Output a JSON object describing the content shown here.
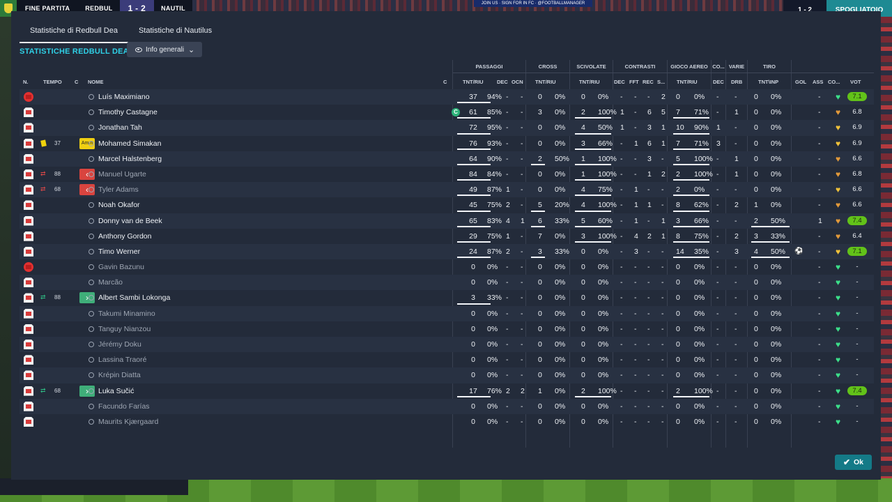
{
  "scoreboard": {
    "status": "FINE PARTITA",
    "home": "REDBUL",
    "score": "1 - 2",
    "away": "NAUTIL",
    "mini_score": "1 - 2",
    "button": "SPOGLIATOIO",
    "ad": "JOIN US · SIGN FOR IN FC · @FOOTBALLMANAGER"
  },
  "tabs": [
    "Statistiche di Redbull Dea",
    "Statistiche di Nautilus"
  ],
  "section_title": "STATISTICHE REDBULL DEA",
  "dropdown": {
    "label": "Info generali",
    "icon": "eye-icon"
  },
  "group_headers": {
    "passaggi": "PASSAGGI",
    "cross": "CROSS",
    "scivolate": "SCIVOLATE",
    "contrasti": "CONTRASTI",
    "gioco_aereo": "GIOCO AEREO",
    "co": "CO...",
    "varie": "VARIE",
    "tiro": "TIRO"
  },
  "column_headers": {
    "n": "N.",
    "tempo": "TEMPO",
    "c": "C",
    "nome": "NOME",
    "cap": "C",
    "pass": "TNT/RIU",
    "pass_dec": "DEC",
    "pass_ocn": "OCN",
    "cross": "TNT/RIU",
    "sciv": "TNT/RIU",
    "con_dec": "DEC",
    "con_fft": "FFT",
    "con_rec": "REC",
    "con_s": "S...",
    "aereo": "TNT/RIU",
    "co_dec": "DEC",
    "drb": "DRB",
    "tiro": "TNT\\INP",
    "gol": "GOL",
    "ass": "ASS",
    "co": "CO...",
    "vot": "VOT"
  },
  "ok_label": "Ok",
  "colors": {
    "accent": "#2fd0e6",
    "good_vote": "#62c219",
    "heart_green": "#3ce08a",
    "heart_orange": "#e39a3a",
    "heart_gold": "#f0c23a"
  },
  "players": [
    {
      "name": "Luís Maximiano",
      "pass": [
        "37",
        "94%"
      ],
      "pdec": "-",
      "pocn": "-",
      "cross": [
        "0",
        "0%"
      ],
      "sciv": [
        "0",
        "0%"
      ],
      "con": [
        "-",
        "-",
        "-",
        "2"
      ],
      "aereo": [
        "0",
        "0%"
      ],
      "codec": "-",
      "drb": "-",
      "tiro": [
        "0",
        "0%"
      ],
      "gol": "",
      "ass": "-",
      "heart": "green",
      "vote": "7.1"
    },
    {
      "name": "Timothy Castagne",
      "pass": [
        "61",
        "85%"
      ],
      "pdec": "-",
      "pocn": "-",
      "cross": [
        "3",
        "0%"
      ],
      "sciv": [
        "2",
        "100%"
      ],
      "con": [
        "1",
        "-",
        "6",
        "5"
      ],
      "aereo": [
        "7",
        "71%"
      ],
      "codec": "-",
      "drb": "1",
      "tiro": [
        "0",
        "0%"
      ],
      "gol": "",
      "ass": "-",
      "heart": "orange",
      "vote": "6.8"
    },
    {
      "name": "Jonathan Tah",
      "pass": [
        "72",
        "95%"
      ],
      "pdec": "-",
      "pocn": "-",
      "cross": [
        "0",
        "0%"
      ],
      "sciv": [
        "4",
        "50%"
      ],
      "con": [
        "1",
        "-",
        "3",
        "1"
      ],
      "aereo": [
        "10",
        "90%"
      ],
      "codec": "1",
      "drb": "-",
      "tiro": [
        "0",
        "0%"
      ],
      "gol": "",
      "ass": "-",
      "heart": "gold",
      "vote": "6.9"
    },
    {
      "name": "Mohamed Simakan",
      "minute": "37",
      "tag": "Amm",
      "pass": [
        "76",
        "93%"
      ],
      "pdec": "-",
      "pocn": "-",
      "cross": [
        "0",
        "0%"
      ],
      "sciv": [
        "3",
        "66%"
      ],
      "con": [
        "-",
        "1",
        "6",
        "1"
      ],
      "aereo": [
        "7",
        "71%"
      ],
      "codec": "3",
      "drb": "-",
      "tiro": [
        "0",
        "0%"
      ],
      "gol": "",
      "ass": "-",
      "heart": "gold",
      "vote": "6.9"
    },
    {
      "name": "Marcel Halstenberg",
      "pass": [
        "64",
        "90%"
      ],
      "pdec": "-",
      "pocn": "-",
      "cross": [
        "2",
        "50%"
      ],
      "sciv": [
        "1",
        "100%"
      ],
      "con": [
        "-",
        "-",
        "3",
        "-"
      ],
      "aereo": [
        "5",
        "100%"
      ],
      "codec": "-",
      "drb": "1",
      "tiro": [
        "0",
        "0%"
      ],
      "gol": "",
      "ass": "-",
      "heart": "orange",
      "vote": "6.6"
    },
    {
      "name": "Manuel Ugarte",
      "minute": "88",
      "pass": [
        "84",
        "84%"
      ],
      "pdec": "-",
      "pocn": "-",
      "cross": [
        "0",
        "0%"
      ],
      "sciv": [
        "1",
        "100%"
      ],
      "con": [
        "-",
        "-",
        "1",
        "2"
      ],
      "aereo": [
        "2",
        "100%"
      ],
      "codec": "-",
      "drb": "1",
      "tiro": [
        "0",
        "0%"
      ],
      "gol": "",
      "ass": "-",
      "heart": "orange",
      "vote": "6.8"
    },
    {
      "name": "Tyler Adams",
      "minute": "68",
      "pass": [
        "49",
        "87%"
      ],
      "pdec": "1",
      "pocn": "-",
      "cross": [
        "0",
        "0%"
      ],
      "sciv": [
        "4",
        "75%"
      ],
      "con": [
        "-",
        "1",
        "-",
        "-"
      ],
      "aereo": [
        "2",
        "0%"
      ],
      "codec": "-",
      "drb": "-",
      "tiro": [
        "0",
        "0%"
      ],
      "gol": "",
      "ass": "-",
      "heart": "gold",
      "vote": "6.6"
    },
    {
      "name": "Noah Okafor",
      "pass": [
        "45",
        "75%"
      ],
      "pdec": "2",
      "pocn": "-",
      "cross": [
        "5",
        "20%"
      ],
      "sciv": [
        "4",
        "100%"
      ],
      "con": [
        "-",
        "1",
        "1",
        "-"
      ],
      "aereo": [
        "8",
        "62%"
      ],
      "codec": "-",
      "drb": "2",
      "tiro": [
        "1",
        "0%"
      ],
      "gol": "",
      "ass": "-",
      "heart": "orange",
      "vote": "6.6"
    },
    {
      "name": "Donny van de Beek",
      "pass": [
        "65",
        "83%"
      ],
      "pdec": "4",
      "pocn": "1",
      "cross": [
        "6",
        "33%"
      ],
      "sciv": [
        "5",
        "60%"
      ],
      "con": [
        "-",
        "1",
        "-",
        "1"
      ],
      "aereo": [
        "3",
        "66%"
      ],
      "codec": "-",
      "drb": "-",
      "tiro": [
        "2",
        "50%"
      ],
      "gol": "",
      "ass": "1",
      "heart": "orange",
      "vote": "7.4"
    },
    {
      "name": "Anthony Gordon",
      "pass": [
        "29",
        "75%"
      ],
      "pdec": "1",
      "pocn": "-",
      "cross": [
        "7",
        "0%"
      ],
      "sciv": [
        "3",
        "100%"
      ],
      "con": [
        "-",
        "4",
        "2",
        "1"
      ],
      "aereo": [
        "8",
        "75%"
      ],
      "codec": "-",
      "drb": "2",
      "tiro": [
        "3",
        "33%"
      ],
      "gol": "",
      "ass": "-",
      "heart": "orange",
      "vote": "6.4"
    },
    {
      "name": "Timo Werner",
      "pass": [
        "24",
        "87%"
      ],
      "pdec": "2",
      "pocn": "-",
      "cross": [
        "3",
        "33%"
      ],
      "sciv": [
        "0",
        "0%"
      ],
      "con": [
        "-",
        "3",
        "-",
        "-"
      ],
      "aereo": [
        "14",
        "35%"
      ],
      "codec": "-",
      "drb": "3",
      "tiro": [
        "4",
        "50%"
      ],
      "gol": "ball",
      "ass": "-",
      "heart": "gold",
      "vote": "7.1"
    },
    {
      "name": "Gavin Bazunu",
      "pass": [
        "0",
        "0%"
      ],
      "pdec": "-",
      "pocn": "-",
      "cross": [
        "0",
        "0%"
      ],
      "sciv": [
        "0",
        "0%"
      ],
      "con": [
        "-",
        "-",
        "-",
        "-"
      ],
      "aereo": [
        "0",
        "0%"
      ],
      "codec": "-",
      "drb": "-",
      "tiro": [
        "0",
        "0%"
      ],
      "gol": "",
      "ass": "-",
      "heart": "green",
      "vote": "-"
    },
    {
      "name": "Marcão",
      "pass": [
        "0",
        "0%"
      ],
      "pdec": "-",
      "pocn": "-",
      "cross": [
        "0",
        "0%"
      ],
      "sciv": [
        "0",
        "0%"
      ],
      "con": [
        "-",
        "-",
        "-",
        "-"
      ],
      "aereo": [
        "0",
        "0%"
      ],
      "codec": "-",
      "drb": "-",
      "tiro": [
        "0",
        "0%"
      ],
      "gol": "",
      "ass": "-",
      "heart": "green",
      "vote": "-"
    },
    {
      "name": "Albert Sambi Lokonga",
      "minute": "88",
      "pass": [
        "3",
        "33%"
      ],
      "pdec": "-",
      "pocn": "-",
      "cross": [
        "0",
        "0%"
      ],
      "sciv": [
        "0",
        "0%"
      ],
      "con": [
        "-",
        "-",
        "-",
        "-"
      ],
      "aereo": [
        "0",
        "0%"
      ],
      "codec": "-",
      "drb": "-",
      "tiro": [
        "0",
        "0%"
      ],
      "gol": "",
      "ass": "-",
      "heart": "green",
      "vote": "-"
    },
    {
      "name": "Takumi Minamino",
      "pass": [
        "0",
        "0%"
      ],
      "pdec": "-",
      "pocn": "-",
      "cross": [
        "0",
        "0%"
      ],
      "sciv": [
        "0",
        "0%"
      ],
      "con": [
        "-",
        "-",
        "-",
        "-"
      ],
      "aereo": [
        "0",
        "0%"
      ],
      "codec": "-",
      "drb": "-",
      "tiro": [
        "0",
        "0%"
      ],
      "gol": "",
      "ass": "-",
      "heart": "green",
      "vote": "-"
    },
    {
      "name": "Tanguy Nianzou",
      "pass": [
        "0",
        "0%"
      ],
      "pdec": "-",
      "pocn": "-",
      "cross": [
        "0",
        "0%"
      ],
      "sciv": [
        "0",
        "0%"
      ],
      "con": [
        "-",
        "-",
        "-",
        "-"
      ],
      "aereo": [
        "0",
        "0%"
      ],
      "codec": "-",
      "drb": "-",
      "tiro": [
        "0",
        "0%"
      ],
      "gol": "",
      "ass": "-",
      "heart": "green",
      "vote": "-"
    },
    {
      "name": "Jérémy Doku",
      "pass": [
        "0",
        "0%"
      ],
      "pdec": "-",
      "pocn": "-",
      "cross": [
        "0",
        "0%"
      ],
      "sciv": [
        "0",
        "0%"
      ],
      "con": [
        "-",
        "-",
        "-",
        "-"
      ],
      "aereo": [
        "0",
        "0%"
      ],
      "codec": "-",
      "drb": "-",
      "tiro": [
        "0",
        "0%"
      ],
      "gol": "",
      "ass": "-",
      "heart": "green",
      "vote": "-"
    },
    {
      "name": "Lassina Traoré",
      "pass": [
        "0",
        "0%"
      ],
      "pdec": "-",
      "pocn": "-",
      "cross": [
        "0",
        "0%"
      ],
      "sciv": [
        "0",
        "0%"
      ],
      "con": [
        "-",
        "-",
        "-",
        "-"
      ],
      "aereo": [
        "0",
        "0%"
      ],
      "codec": "-",
      "drb": "-",
      "tiro": [
        "0",
        "0%"
      ],
      "gol": "",
      "ass": "-",
      "heart": "green",
      "vote": "-"
    },
    {
      "name": "Krépin Diatta",
      "pass": [
        "0",
        "0%"
      ],
      "pdec": "-",
      "pocn": "-",
      "cross": [
        "0",
        "0%"
      ],
      "sciv": [
        "0",
        "0%"
      ],
      "con": [
        "-",
        "-",
        "-",
        "-"
      ],
      "aereo": [
        "0",
        "0%"
      ],
      "codec": "-",
      "drb": "-",
      "tiro": [
        "0",
        "0%"
      ],
      "gol": "",
      "ass": "-",
      "heart": "green",
      "vote": "-"
    },
    {
      "name": "Luka Sučić",
      "minute": "68",
      "pass": [
        "17",
        "76%"
      ],
      "pdec": "2",
      "pocn": "2",
      "cross": [
        "1",
        "0%"
      ],
      "sciv": [
        "2",
        "100%"
      ],
      "con": [
        "-",
        "-",
        "-",
        "-"
      ],
      "aereo": [
        "2",
        "100%"
      ],
      "codec": "-",
      "drb": "-",
      "tiro": [
        "0",
        "0%"
      ],
      "gol": "",
      "ass": "-",
      "heart": "green",
      "vote": "7.4"
    },
    {
      "name": "Facundo Farías",
      "pass": [
        "0",
        "0%"
      ],
      "pdec": "-",
      "pocn": "-",
      "cross": [
        "0",
        "0%"
      ],
      "sciv": [
        "0",
        "0%"
      ],
      "con": [
        "-",
        "-",
        "-",
        "-"
      ],
      "aereo": [
        "0",
        "0%"
      ],
      "codec": "-",
      "drb": "-",
      "tiro": [
        "0",
        "0%"
      ],
      "gol": "",
      "ass": "-",
      "heart": "green",
      "vote": "-"
    },
    {
      "name": "Maurits Kjærgaard",
      "pass": [
        "0",
        "0%"
      ],
      "pdec": "-",
      "pocn": "-",
      "cross": [
        "0",
        "0%"
      ],
      "sciv": [
        "0",
        "0%"
      ],
      "con": [
        "-",
        "-",
        "-",
        "-"
      ],
      "aereo": [
        "0",
        "0%"
      ],
      "codec": "-",
      "drb": "-",
      "tiro": [
        "0",
        "0%"
      ],
      "gol": "",
      "ass": "-",
      "heart": "green",
      "vote": "-"
    }
  ]
}
